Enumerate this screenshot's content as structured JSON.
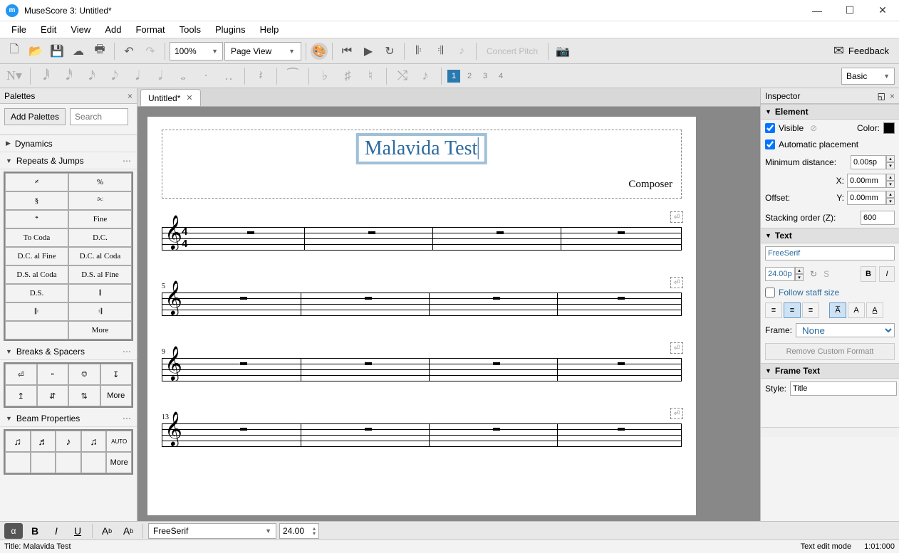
{
  "window": {
    "title": "MuseScore 3: Untitled*",
    "icon": "m"
  },
  "menubar": [
    "File",
    "Edit",
    "View",
    "Add",
    "Format",
    "Tools",
    "Plugins",
    "Help"
  ],
  "toolbar": {
    "zoom": "100%",
    "view_mode": "Page View",
    "concert_pitch": "Concert Pitch",
    "feedback": "Feedback"
  },
  "secondary": {
    "voices": [
      "1",
      "2",
      "3",
      "4"
    ],
    "workspace": "Basic"
  },
  "palettes": {
    "title": "Palettes",
    "add_btn": "Add Palettes",
    "search_placeholder": "Search",
    "categories": {
      "dynamics": "Dynamics",
      "repeats": "Repeats & Jumps",
      "breaks": "Breaks & Spacers",
      "beams": "Beam Properties"
    },
    "repeats_items": [
      "𝄎",
      "%",
      "§",
      "𝄊",
      "𝄌",
      "Fine",
      "To Coda",
      "D.C.",
      "D.C. al Fine",
      "D.C. al Coda",
      "D.S. al Coda",
      "D.S. al Fine",
      "D.S.",
      "𝄂",
      "𝄆",
      "𝄇",
      "",
      "More"
    ],
    "breaks_more": "More",
    "beams_auto": "AUTO",
    "beams_more": "More"
  },
  "doc": {
    "tab_name": "Untitled*",
    "title": "Malavida Test",
    "composer": "Composer",
    "time_sig": {
      "num": "4",
      "den": "4"
    },
    "measure_numbers": [
      "5",
      "9",
      "13"
    ]
  },
  "inspector": {
    "title": "Inspector",
    "element_section": "Element",
    "visible_label": "Visible",
    "color_label": "Color:",
    "auto_place_label": "Automatic placement",
    "min_dist_label": "Minimum distance:",
    "min_dist_val": "0.00sp",
    "offset_label": "Offset:",
    "x_label": "X:",
    "x_val": "0.00mm",
    "y_label": "Y:",
    "y_val": "0.00mm",
    "stack_label": "Stacking order (Z):",
    "stack_val": "600",
    "text_section": "Text",
    "font_name": "FreeSerif",
    "font_size": "24.00p",
    "follow_staff": "Follow staff size",
    "frame_label": "Frame:",
    "frame_val": "None",
    "remove_btn": "Remove Custom Formatt",
    "frametext_section": "Frame Text",
    "style_label": "Style:",
    "style_val": "Title"
  },
  "bottom_bar": {
    "font": "FreeSerif",
    "size": "24.00"
  },
  "status": {
    "left": "Title: Malavida Test",
    "mode": "Text edit mode",
    "pos": "1:01:000"
  }
}
